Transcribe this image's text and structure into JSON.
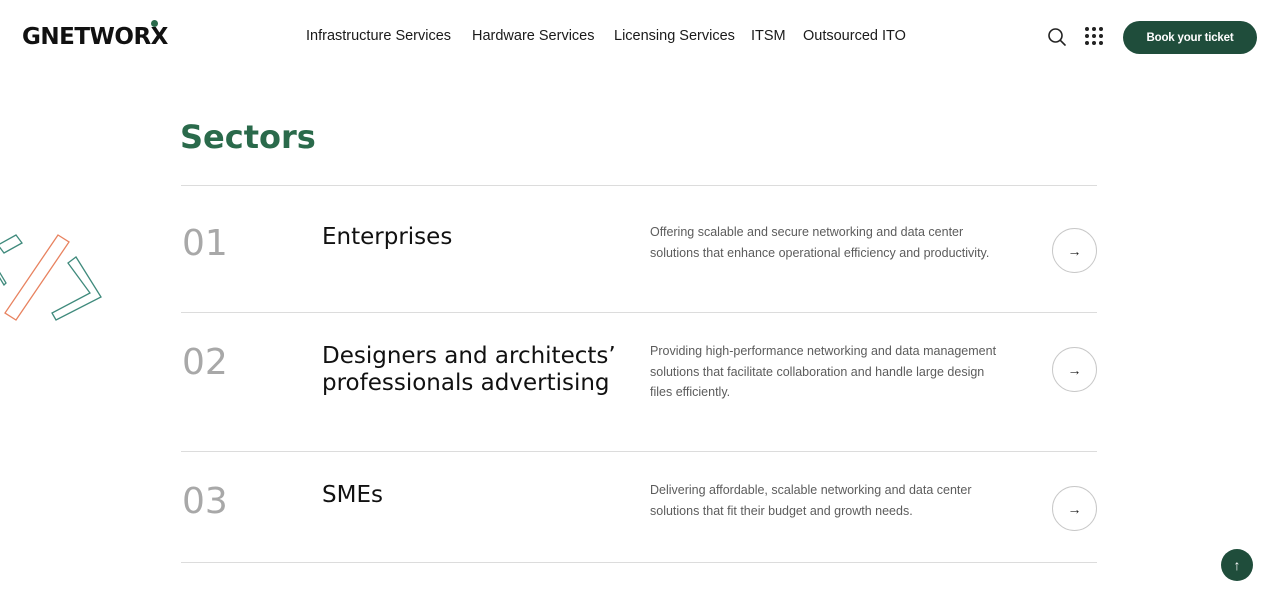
{
  "header": {
    "logo": "GNETWORX",
    "nav": [
      "Infrastructure Services",
      "Hardware Services",
      "Licensing Services",
      "ITSM",
      "Outsourced ITO"
    ],
    "book_label": "Book your ticket"
  },
  "colors": {
    "brand_green": "#1f4d3b",
    "title_green": "#2a6a4b",
    "deco_orange": "#e8825f",
    "deco_teal": "#3f8a7c"
  },
  "icons": {
    "search": "search-icon",
    "apps": "grid-icon",
    "arrow": "arrow-right-icon",
    "top": "arrow-up-icon"
  },
  "sectors": {
    "title": "Sectors",
    "items": [
      {
        "num": "01",
        "title": "Enterprises",
        "desc": "Offering scalable and secure networking and data center solutions that enhance operational efficiency and productivity."
      },
      {
        "num": "02",
        "title": "Designers and architects’ professionals advertising",
        "desc": "Providing high-performance networking and data management solutions that facilitate collaboration and handle large design files efficiently."
      },
      {
        "num": "03",
        "title": "SMEs",
        "desc": "Delivering affordable, scalable networking and data center solutions that fit their budget and growth needs."
      }
    ],
    "arrow_glyph": "→",
    "top_glyph": "↑"
  }
}
